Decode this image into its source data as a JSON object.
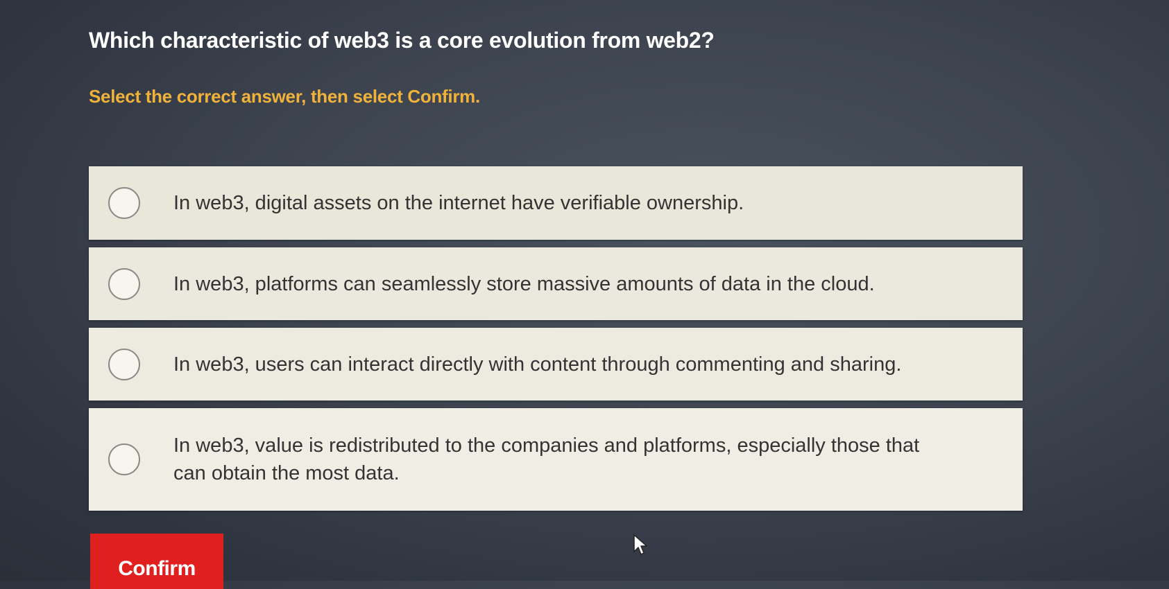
{
  "question": {
    "title": "Which characteristic of web3 is a core evolution from web2?",
    "instruction": "Select the correct answer, then select Confirm."
  },
  "options": [
    {
      "text": "In web3, digital assets on the internet have verifiable ownership.",
      "selected": false
    },
    {
      "text": "In web3, platforms can seamlessly store massive amounts of data in the cloud.",
      "selected": false
    },
    {
      "text": "In web3, users can interact directly with content through commenting and sharing.",
      "selected": false
    },
    {
      "text": "In web3, value is redistributed to the companies and platforms, especially those that can obtain the most data.",
      "selected": false
    }
  ],
  "confirm": {
    "label": "Confirm"
  },
  "colors": {
    "background": "#3d444f",
    "title": "#ffffff",
    "instruction": "#f0b23a",
    "option_bg": "#eeeade",
    "confirm_bg": "#e0201f"
  },
  "icons": {
    "cursor": "mouse-pointer-icon",
    "radio": "radio-circle-icon"
  }
}
